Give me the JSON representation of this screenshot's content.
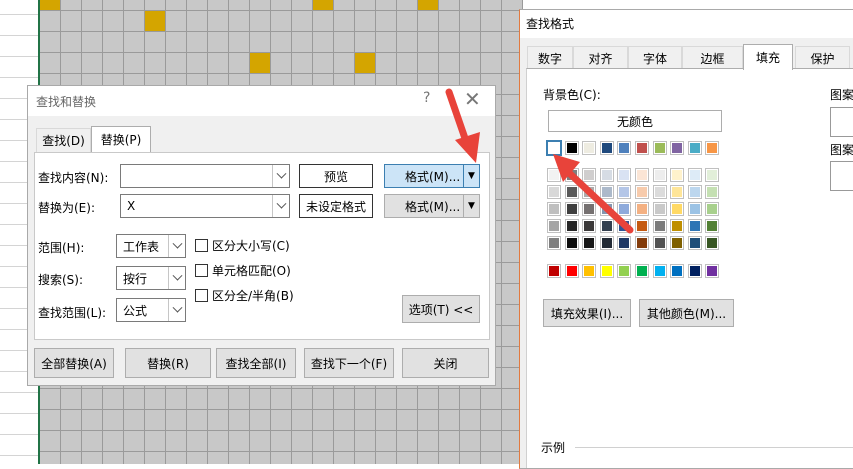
{
  "find_replace": {
    "title": "查找和替换",
    "help": "?",
    "close": "✕",
    "tabs": [
      "查找(D)",
      "替换(P)"
    ],
    "find_label": "查找内容(N):",
    "find_value": "",
    "preview_label": "预览",
    "format_btn_1": "格式(M)...",
    "replace_label": "替换为(E):",
    "replace_value": "X",
    "no_format_label": "未设定格式",
    "format_btn_2": "格式(M)...",
    "scope_label": "范围(H):",
    "scope_value": "工作表",
    "search_label": "搜索(S):",
    "search_value": "按行",
    "lookin_label": "查找范围(L):",
    "lookin_value": "公式",
    "opt_case": "区分大小写(C)",
    "opt_cell": "单元格匹配(O)",
    "opt_width": "区分全/半角(B)",
    "options_btn": "选项(T) <<",
    "replace_all": "全部替换(A)",
    "replace_one": "替换(R)",
    "find_all": "查找全部(I)",
    "find_next": "查找下一个(F)",
    "close_btn": "关闭"
  },
  "format_dialog": {
    "title": "查找格式",
    "tabs": [
      "数字",
      "对齐",
      "字体",
      "边框",
      "填充",
      "保护"
    ],
    "active_tab": "填充",
    "bg_label": "背景色(C):",
    "no_color": "无颜色",
    "pattern_label_1": "图案",
    "pattern_label_2": "图案",
    "fill_effects": "填充效果(I)...",
    "more_colors": "其他颜色(M)...",
    "sample_label": "示例"
  },
  "colors": {
    "theme_row": [
      "#ffffff",
      "#000000",
      "#e7e6e6",
      "#44546a",
      "#4472c4",
      "#ed7d31",
      "#a5a5a5",
      "#ffc000",
      "#5b9bd5",
      "#70ad47"
    ],
    "shades": [
      [
        "#f2f2f2",
        "#7f7f7f",
        "#d0cece",
        "#d6dce4",
        "#d9e2f3",
        "#fbe5d5",
        "#ededed",
        "#fff2cc",
        "#ddebf7",
        "#e2efd9"
      ],
      [
        "#d8d8d8",
        "#595959",
        "#aeabab",
        "#acb9ca",
        "#b4c6e7",
        "#f7cbac",
        "#dbdbdb",
        "#fee599",
        "#bdd7ee",
        "#c5e0b3"
      ],
      [
        "#bfbfbf",
        "#3f3f3f",
        "#757070",
        "#8496b0",
        "#8eaadb",
        "#f4b183",
        "#c9c9c9",
        "#ffd965",
        "#9cc3e5",
        "#a8d08d"
      ],
      [
        "#a5a5a5",
        "#262626",
        "#3a3838",
        "#323f4f",
        "#2f5496",
        "#c55a11",
        "#7b7b7b",
        "#bf8f00",
        "#2e75b5",
        "#538135"
      ],
      [
        "#7f7f7f",
        "#0c0c0c",
        "#161616",
        "#222a35",
        "#1f3864",
        "#833c0b",
        "#525252",
        "#7f6000",
        "#1e4e79",
        "#375623"
      ]
    ],
    "standard_row": [
      "#c00000",
      "#ff0000",
      "#ffc000",
      "#ffff00",
      "#92d050",
      "#00b050",
      "#00b0f0",
      "#0070c0",
      "#002060",
      "#7030a0"
    ],
    "theme_row_display": [
      "#ffffff",
      "#000000",
      "#eeece1",
      "#1f497d",
      "#4f81bd",
      "#c0504d",
      "#9bbb59",
      "#8064a2",
      "#4bacc6",
      "#f79646"
    ],
    "highlight_cell": "#d4a500",
    "arrow": "#e8433a"
  }
}
